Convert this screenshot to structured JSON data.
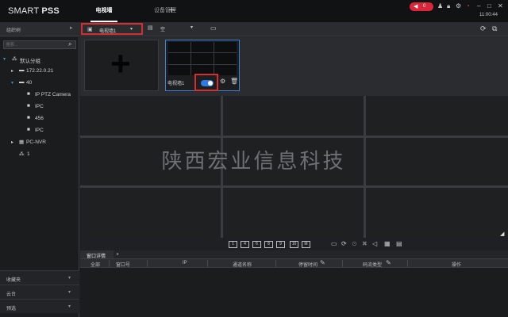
{
  "title_bar": {
    "app_name_light": "SMART ",
    "app_name_bold": "PSS",
    "tabs": [
      {
        "label": "电视墙",
        "active": true
      },
      {
        "label": "设备管理",
        "active": false
      }
    ],
    "add_tab": "+",
    "alarm_count": "0",
    "clock": "11:00:44",
    "icons": [
      "alarm-icon",
      "user-icon",
      "lock-icon",
      "settings-icon",
      "performance-icon",
      "minimize-icon",
      "maximize-icon",
      "close-icon"
    ]
  },
  "toolbar": {
    "org_label": "组织树",
    "wall_select_value": "电视墙1",
    "task_select_value": "空",
    "icons": [
      "tv-wall-icon",
      "task-icon",
      "save-icon",
      "refresh-icon",
      "screen-config-icon"
    ]
  },
  "sidebar": {
    "search_placeholder": "搜索...",
    "tree": [
      {
        "label": "默认分组",
        "level": 0,
        "expanded": true
      },
      {
        "label": "172.22.0.21",
        "level": 1,
        "expanded": false
      },
      {
        "label": "40",
        "level": 1,
        "expanded": true
      },
      {
        "label": "IP PTZ Camera",
        "level": 2
      },
      {
        "label": "IPC",
        "level": 2
      },
      {
        "label": "456",
        "level": 2
      },
      {
        "label": "IPC",
        "level": 2
      },
      {
        "label": "PC-NVR",
        "level": 1,
        "expanded": false
      },
      {
        "label": "1",
        "level": 1
      }
    ],
    "bottom_items": [
      {
        "label": "收藏夹"
      },
      {
        "label": "云台"
      },
      {
        "label": "预选"
      }
    ]
  },
  "screen_strip": {
    "add_symbol": "+",
    "wall_thumbnail_label": "电视墙1",
    "toggle_on": true,
    "accent_color": "#2f7ae5"
  },
  "video_wall": {
    "rows": 3,
    "cols": 3,
    "watermark": "陕西宏业信息科技"
  },
  "bottom_panel": {
    "layout_buttons": [
      "1",
      "4",
      "6",
      "8",
      "9",
      "16",
      "M"
    ],
    "detail_tab": "窗口详情",
    "columns": [
      "全部",
      "窗口号",
      "IP",
      "通道名称",
      "停留时间",
      "码流类型",
      "操作"
    ]
  },
  "colors": {
    "highlight": "#d62e2e",
    "alarm": "#d9263a",
    "tree_arrow": "#3d8fe0"
  }
}
